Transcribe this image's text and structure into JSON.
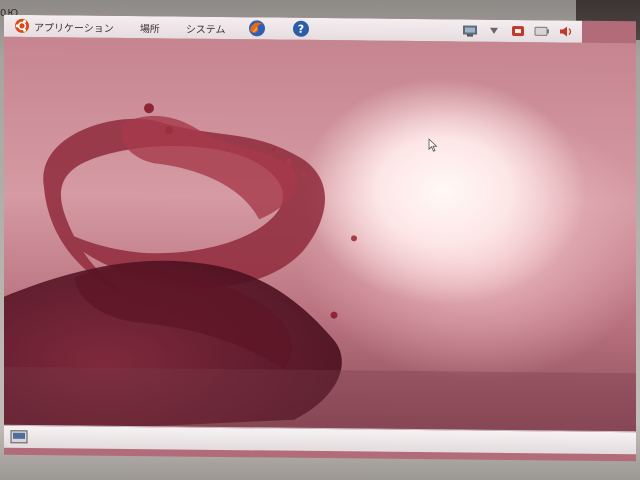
{
  "bezel": {
    "left_text": "0Ю",
    "right_text": ""
  },
  "top_panel": {
    "menus": [
      {
        "label": "アプリケーション",
        "icon": "ubuntu-logo-icon"
      },
      {
        "label": "場所"
      },
      {
        "label": "システム"
      }
    ],
    "launchers": [
      {
        "icon": "firefox-icon"
      },
      {
        "icon": "help-icon"
      }
    ],
    "tray": [
      {
        "icon": "network-icon"
      },
      {
        "icon": "arrow-down-icon"
      },
      {
        "icon": "update-notifier-icon"
      },
      {
        "icon": "battery-icon"
      },
      {
        "icon": "volume-icon"
      }
    ]
  },
  "desktop": {
    "wallpaper": "red-swirl-wallpaper"
  },
  "bottom_panel": {
    "items": [
      {
        "icon": "show-desktop-icon"
      }
    ]
  },
  "colors": {
    "panel_bg": "#ede6e8",
    "wallpaper_dark": "#8b4a58",
    "wallpaper_light": "#fff9f6"
  }
}
